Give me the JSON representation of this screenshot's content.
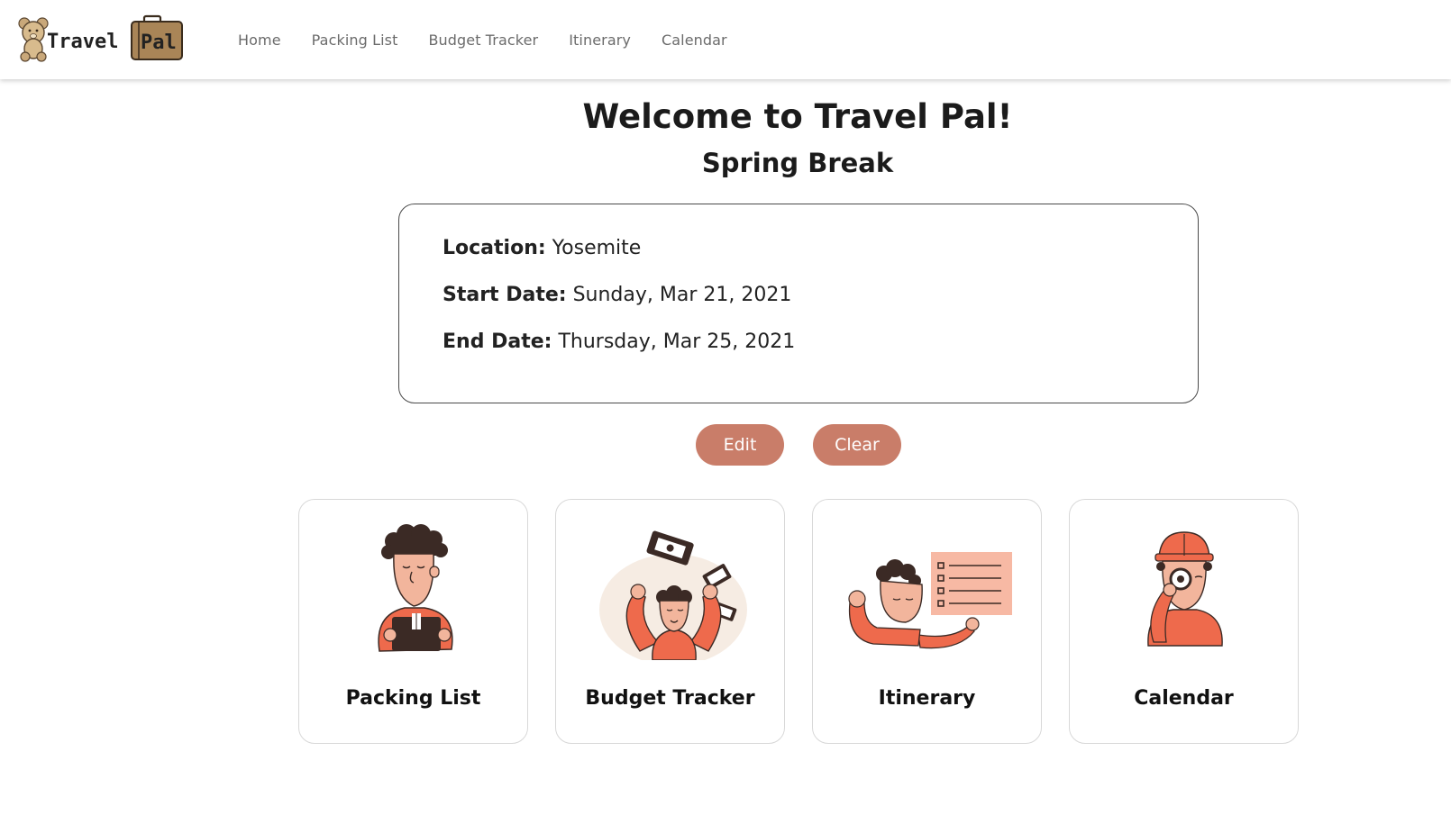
{
  "brand": {
    "logo_text_1": "Travel",
    "logo_text_2": "Pal"
  },
  "nav": {
    "items": [
      {
        "label": "Home"
      },
      {
        "label": "Packing List"
      },
      {
        "label": "Budget Tracker"
      },
      {
        "label": "Itinerary"
      },
      {
        "label": "Calendar"
      }
    ]
  },
  "header": {
    "title": "Welcome to Travel Pal!",
    "trip_name": "Spring Break"
  },
  "trip": {
    "location_label": "Location:",
    "location_value": "Yosemite",
    "start_label": "Start Date:",
    "start_value": "Sunday, Mar 21, 2021",
    "end_label": "End Date:",
    "end_value": "Thursday, Mar 25, 2021"
  },
  "actions": {
    "edit_label": "Edit",
    "clear_label": "Clear"
  },
  "features": [
    {
      "label": "Packing List",
      "icon": "person-holding-suitcase-icon"
    },
    {
      "label": "Budget Tracker",
      "icon": "person-with-money-icon"
    },
    {
      "label": "Itinerary",
      "icon": "person-with-checklist-icon"
    },
    {
      "label": "Calendar",
      "icon": "person-with-magnifier-icon"
    }
  ],
  "colors": {
    "accent": "#c97d69",
    "illustration_orange": "#ee6a4c",
    "illustration_skin": "#f2b59c",
    "illustration_dark": "#3b2a25",
    "illustration_cream": "#f6ece3"
  }
}
